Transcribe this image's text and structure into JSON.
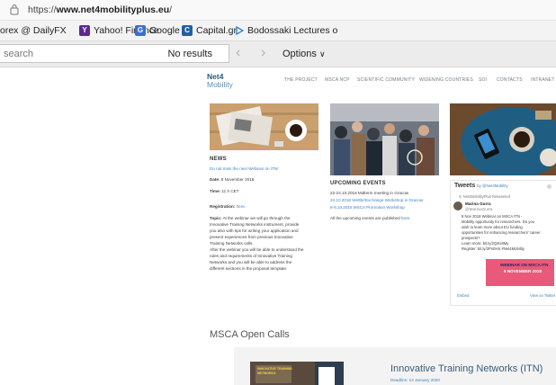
{
  "browser": {
    "url_prefix": "https://",
    "url_domain": "www.net4mobilityplus.eu",
    "url_suffix": "/",
    "bookmarks": [
      {
        "label": "orex @ DailyFX"
      },
      {
        "label": "Yahoo! Finance",
        "icon_letter": "Y"
      },
      {
        "label": "Google",
        "icon_letter": "G"
      },
      {
        "label": "Capital.gr",
        "icon_letter": "C"
      },
      {
        "label": "Bodossaki Lectures o"
      }
    ]
  },
  "findbar": {
    "placeholder": "search",
    "status": "No results",
    "options_label": "Options"
  },
  "site": {
    "logo_line1": "Net4",
    "logo_line2": "Mobility",
    "nav": [
      "THE PROJECT",
      "MSCA NCP",
      "SCIENTIFIC COMMUNITY",
      "WIDENING COUNTRIES",
      "SOI",
      "CONTACTS",
      "INTRANET"
    ],
    "news": {
      "heading": "NEWS",
      "link": "Do not miss the next Webinar on ITN!",
      "date_label": "Date:",
      "date": "8 November 2018",
      "time_label": "Time:",
      "time": "11 h CET",
      "registration_label": "Registration:",
      "registration_link": "here.",
      "topic_label": "Topic:",
      "topic_lines": [
        "At the webinar we will go through the",
        "Innovative Training Networks instrument, provide",
        "you also with tips for writing your application and",
        "present experiences from previous Innovative",
        "Training Networks calls.",
        "After the webinar you will be able to understand the",
        "rules and requirements of Innovative Training",
        "Networks and you will be able to address the",
        "different sections in the proposal template."
      ]
    },
    "events": {
      "heading": "UPCOMING EVENTS",
      "items": [
        "22-24.10.2018 Midterm meeting in Gracow",
        "24.10.2018 Wettbr/Exchange Workshop in Gracow",
        "8-9.10.2018 MSCA Promotion Workshop"
      ],
      "all_text": "All the upcoming events are published",
      "all_link": "here."
    },
    "tweets": {
      "heading": "Tweets",
      "by": "by @Net4Mobility",
      "retweet_line": "Net4MobilityPlus Retweeted",
      "author": "Marina Gurra",
      "handle": "@MarinaGurra",
      "text_lines": [
        "8 Nov 2018 Webinar on MSCA ITN -",
        "Mobility opportunity for researchers. Do you",
        "wish to learn more about EU funding",
        "opportunities for enhancing researchers' career",
        "prospects?",
        "Learn more: bit.ly/2Q4U8My",
        "Register: bit.ly/2Pn0HS #Net4Mobility"
      ],
      "embed_title": "WEBINAR ON MSCA ITN",
      "embed_date": "8 NOVEMBER 2018",
      "embed_link": "Embed",
      "view_link": "View on Twitter"
    },
    "open_calls": {
      "section_title": "MSCA Open Calls",
      "card_title": "Innovative Training Networks (ITN)",
      "card_deadline": "Deadline: 14 January 2020",
      "card_image_text": "INNOVATIVE TRAINING NETWORKS"
    }
  }
}
